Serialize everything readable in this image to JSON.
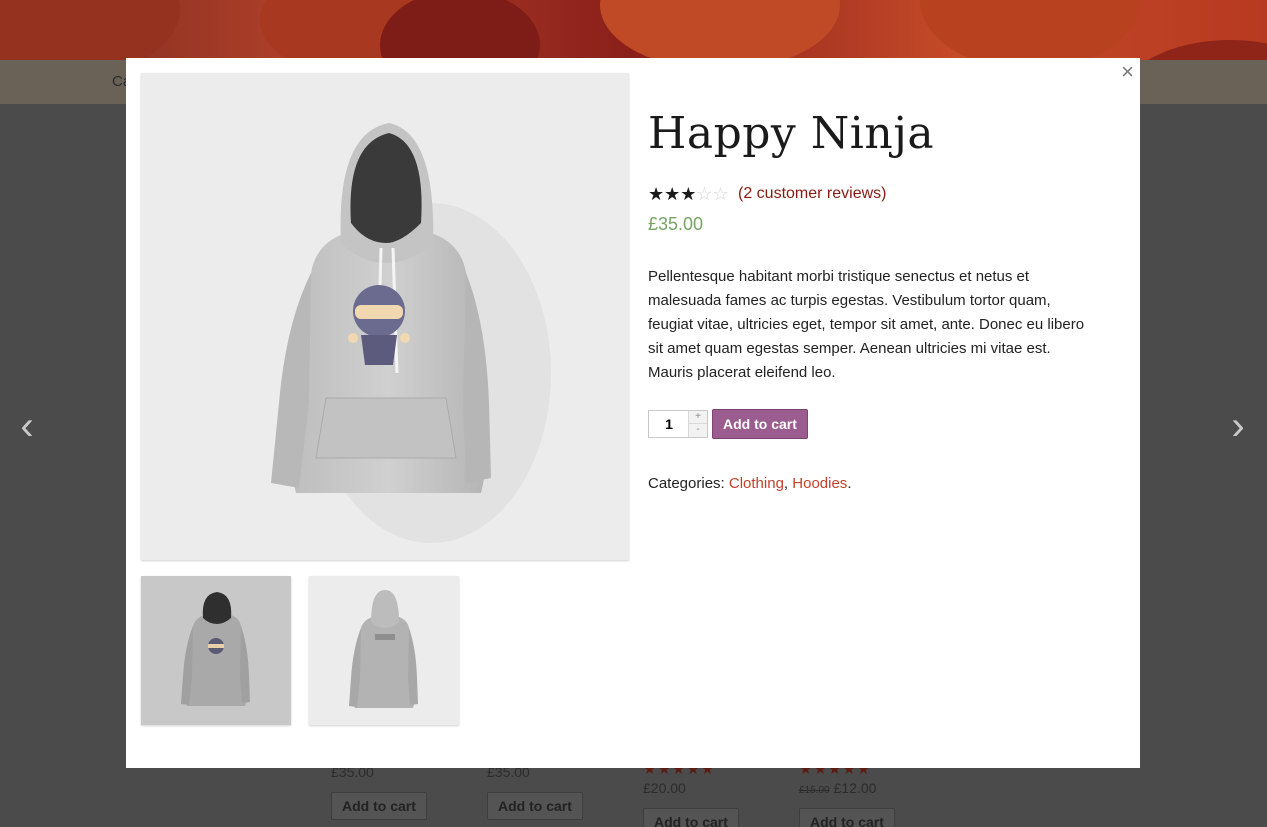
{
  "background": {
    "nav_label": "Ca",
    "products": [
      {
        "price": "£35.00",
        "button": "Add to cart"
      },
      {
        "price": "£35.00",
        "button": "Add to cart"
      },
      {
        "stars": "★★★★★",
        "price": "£20.00",
        "button": "Add to cart"
      },
      {
        "stars": "★★★★★",
        "old_price": "£15.00",
        "price": "£12.00",
        "button": "Add to cart"
      }
    ]
  },
  "modal": {
    "close_label": "×",
    "title": "Happy Ninja",
    "rating": {
      "value": 3,
      "max": 5,
      "full_glyphs": "★★★★★",
      "empty_glyphs": "☆☆☆☆☆",
      "reviews_link": "(2 customer reviews)"
    },
    "price": "£35.00",
    "description": "Pellentesque habitant morbi tristique senectus et netus et malesuada fames ac turpis egestas. Vestibulum tortor quam, feugiat vitae, ultricies eget, tempor sit amet, ante. Donec eu libero sit amet quam egestas semper. Aenean ultricies mi vitae est. Mauris placerat eleifend leo.",
    "quantity": "1",
    "qty_plus": "+",
    "qty_minus": "-",
    "add_to_cart": "Add to cart",
    "categories_label": "Categories: ",
    "categories": [
      "Clothing",
      "Hoodies"
    ],
    "category_separator": ", ",
    "category_end": "."
  },
  "nav_arrows": {
    "prev": "‹",
    "next": "›"
  },
  "colors": {
    "price": "#77a464",
    "button": "#9b5c8f",
    "link": "#8a1a10",
    "category_link": "#c4402a"
  }
}
